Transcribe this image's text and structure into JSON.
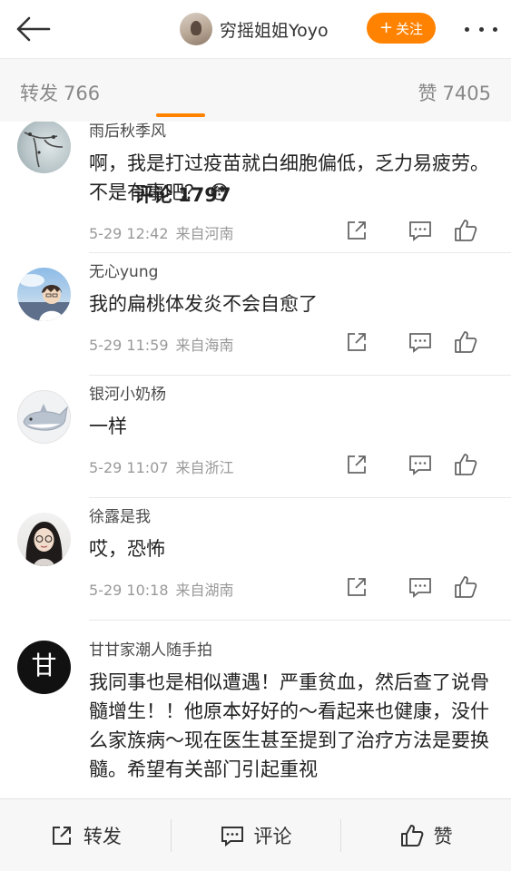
{
  "header": {
    "author_name": "穷摇姐姐Yoyo",
    "follow_label": "关注",
    "icons": {
      "back": "back-arrow-icon",
      "more": "more-dots-icon"
    }
  },
  "tabs": {
    "repost": {
      "label": "转发",
      "count": "766"
    },
    "comments": {
      "label": "评论",
      "count": "1797"
    },
    "likes": {
      "label": "赞",
      "count": "7405"
    }
  },
  "comments": [
    {
      "username": "雨后秋季风",
      "text": "啊，我是打过疫苗就白细胞偏低，乏力易疲劳。不是有事吧？",
      "emoji": "😳",
      "time": "5-29 12:42",
      "location": "来自河南"
    },
    {
      "username": "无心yung",
      "text": "我的扁桃体发炎不会自愈了",
      "time": "5-29 11:59",
      "location": "来自海南"
    },
    {
      "username": "银河小奶杨",
      "text": "一样",
      "time": "5-29 11:07",
      "location": "来自浙江"
    },
    {
      "username": "徐露是我",
      "text": "哎，恐怖",
      "time": "5-29 10:18",
      "location": "来自湖南"
    },
    {
      "username": "甘甘家潮人随手拍",
      "text": "我同事也是相似遭遇！严重贫血，然后查了说骨髓增生！！他原本好好的～看起来也健康，没什么家族病～现在医生甚至提到了治疗方法是要换髓。希望有关部门引起重视",
      "avatar_glyph": "甘"
    }
  ],
  "bottom_bar": {
    "repost": "转发",
    "comment": "评论",
    "like": "赞"
  },
  "colors": {
    "accent": "#ff8200",
    "text": "#222222",
    "muted": "#999999"
  }
}
